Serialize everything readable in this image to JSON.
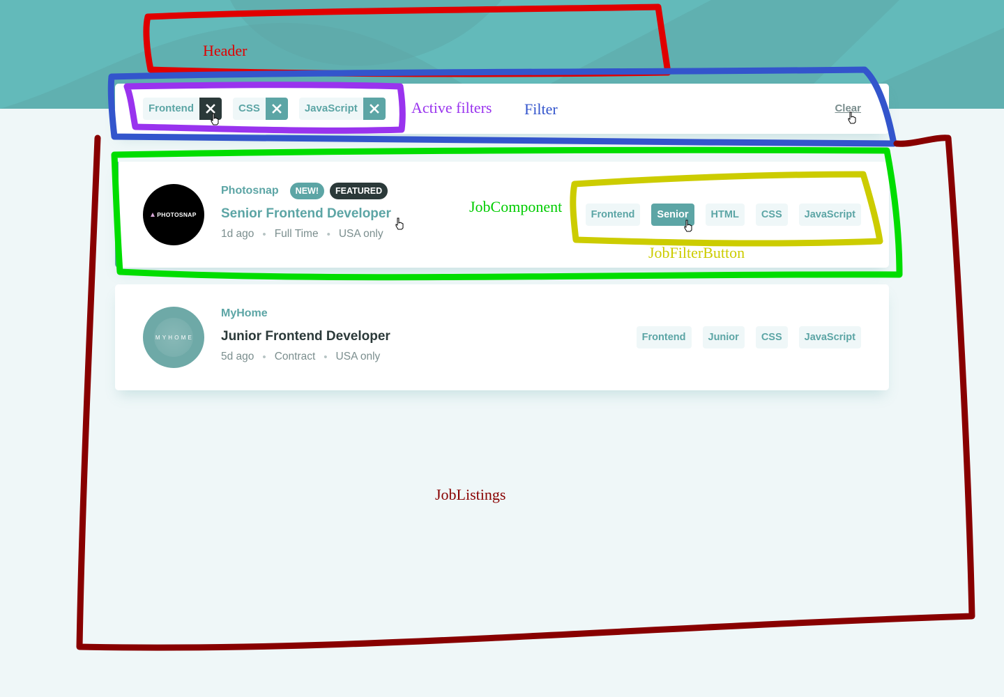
{
  "colors": {
    "primary": "#5ca5a5",
    "dark": "#2b3939",
    "muted": "#7b8e8e",
    "tag_bg": "#eff7f8",
    "header_bg": "#63baba"
  },
  "filter_bar": {
    "active_filters": [
      {
        "label": "Frontend",
        "remove_icon": "close-icon"
      },
      {
        "label": "CSS",
        "remove_icon": "close-icon"
      },
      {
        "label": "JavaScript",
        "remove_icon": "close-icon"
      }
    ],
    "clear_label": "Clear"
  },
  "jobs": [
    {
      "company": "Photosnap",
      "logo_text": "PHOTOSNAP",
      "badges": {
        "new": "NEW!",
        "featured": "FEATURED"
      },
      "position": "Senior Frontend Developer",
      "posted": "1d ago",
      "contract": "Full Time",
      "location": "USA only",
      "tags": [
        "Frontend",
        "Senior",
        "HTML",
        "CSS",
        "JavaScript"
      ]
    },
    {
      "company": "MyHome",
      "logo_text": "MYHOME",
      "position": "Junior Frontend Developer",
      "posted": "5d ago",
      "contract": "Contract",
      "location": "USA only",
      "tags": [
        "Frontend",
        "Junior",
        "CSS",
        "JavaScript"
      ]
    }
  ],
  "annotations": {
    "header": {
      "label": "Header",
      "color": "#e00000"
    },
    "filter": {
      "label": "Filter",
      "color": "#3355cc"
    },
    "active_filters": {
      "label": "Active filters",
      "color": "#9933ee"
    },
    "job_component": {
      "label": "JobComponent",
      "color": "#00cc00"
    },
    "job_filter_button": {
      "label": "JobFilterButton",
      "color": "#cccc00"
    },
    "job_listings": {
      "label": "JobListings",
      "color": "#880000"
    }
  }
}
